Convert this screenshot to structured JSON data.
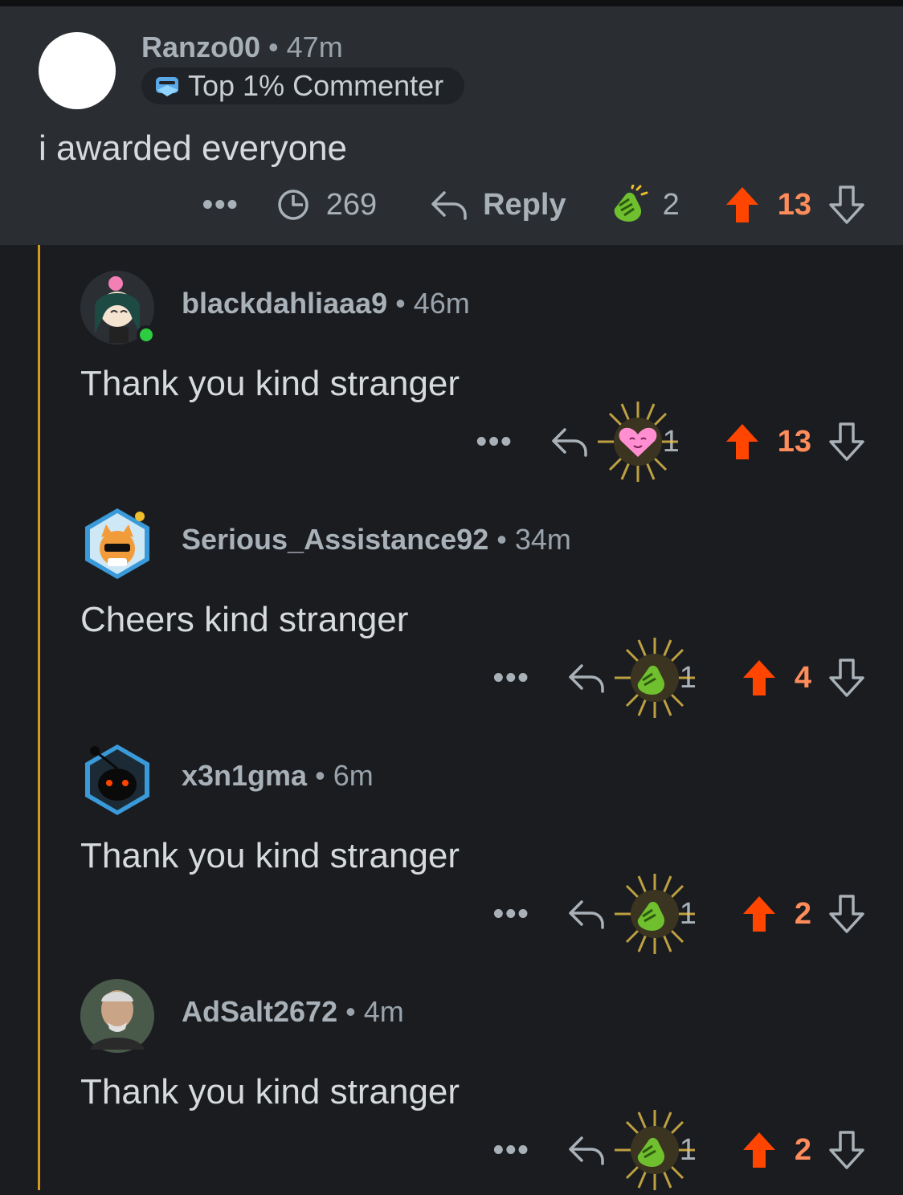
{
  "parent": {
    "username": "Ranzo00",
    "time": "47m",
    "flair": "Top 1% Commenter",
    "body": "i awarded everyone",
    "more": "•••",
    "views": "269",
    "reply_label": "Reply",
    "award_count": "2",
    "score": "13"
  },
  "replies": [
    {
      "username": "blackdahliaaa9",
      "time": "46m",
      "body": "Thank you kind stranger",
      "more": "•••",
      "award_count": "1",
      "score": "13",
      "award": "heart-award-icon"
    },
    {
      "username": "Serious_Assistance92",
      "time": "34m",
      "body": "Cheers kind stranger",
      "more": "•••",
      "award_count": "1",
      "score": "4",
      "award": "clap-award-icon"
    },
    {
      "username": "x3n1gma",
      "time": "6m",
      "body": "Thank you kind stranger",
      "more": "•••",
      "award_count": "1",
      "score": "2",
      "award": "clap-award-icon"
    },
    {
      "username": "AdSalt2672",
      "time": "4m",
      "body": "Thank you kind stranger",
      "more": "•••",
      "award_count": "1",
      "score": "2",
      "award": "clap-award-icon"
    }
  ],
  "colors": {
    "background": "#1a1c20",
    "parent_background": "#2a2e33",
    "thread_line": "#d39a1e",
    "upvote": "#ff4500",
    "score": "#ff8c5a"
  }
}
